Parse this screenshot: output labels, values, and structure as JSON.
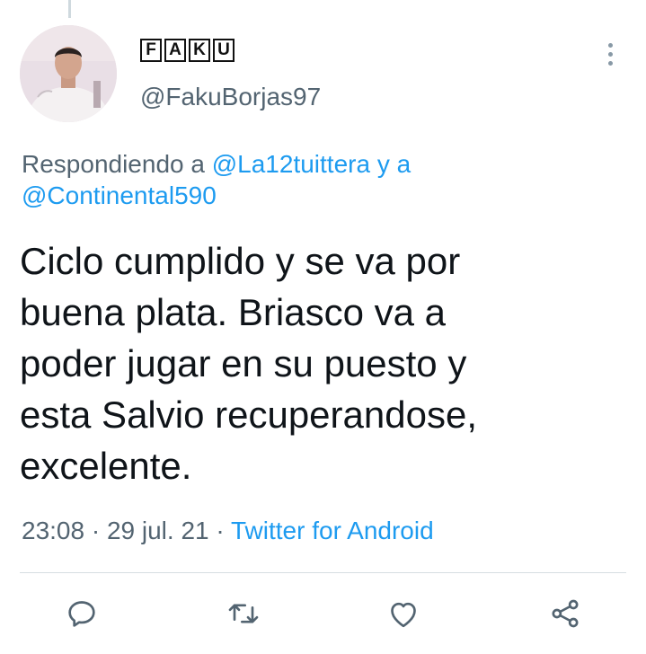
{
  "author": {
    "display_name_letters": [
      "F",
      "A",
      "K",
      "U"
    ],
    "handle": "@FakuBorjas97"
  },
  "reply": {
    "prefix": "Respondiendo a ",
    "mention_1": "@La12tuittera",
    "joiner": " y a ",
    "mention_2": "@Continental590"
  },
  "tweet": {
    "text": "Ciclo cumplido y se va por\nbuena plata. Briasco va a\npoder jugar en su puesto y\nesta Salvio recuperandose,\nexcelente."
  },
  "meta": {
    "time": "23:08",
    "sep1": " · ",
    "date": "29 jul. 21",
    "sep2": " · ",
    "source": "Twitter for Android"
  },
  "actions": {
    "icons": [
      "reply-icon",
      "retweet-icon",
      "like-icon",
      "share-icon"
    ]
  },
  "colors": {
    "accent": "#1d9bf0",
    "secondary_text": "#536471",
    "primary_text": "#0f1419"
  }
}
